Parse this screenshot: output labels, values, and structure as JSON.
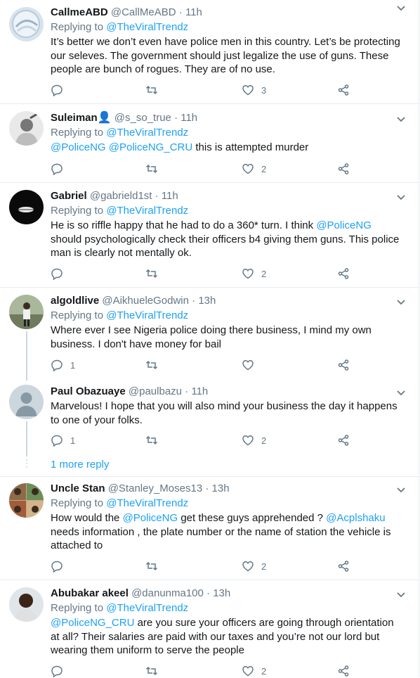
{
  "replying_label": "Replying to",
  "separator": "·",
  "more_replies": "1 more reply",
  "colors": {
    "accent": "#1da1f2",
    "muted": "#657786",
    "border": "#e6ecf0",
    "text": "#14171a"
  },
  "tweets": [
    {
      "name": "CallmeABD",
      "handle": "@CallMeABD",
      "time": "11h",
      "reply_to": "@TheViralTrendz",
      "text": "It’s better we don’t even have police men in this country. Let’s be protecting our seleves.  The government should just legalize the use of guns. These people are bunch of rogues. They are of no use.",
      "replies": "",
      "likes": "3",
      "avatar_icon": "user-avatar"
    },
    {
      "name": "Suleiman",
      "name_emoji": "👤",
      "handle": "@s_so_true",
      "time": "11h",
      "reply_to": "@TheViralTrendz",
      "mention_1": "@PoliceNG",
      "mention_2": "@PoliceNG_CRU",
      "text": "this is attempted murder",
      "replies": "",
      "likes": "2",
      "avatar_icon": "user-avatar"
    },
    {
      "name": "Gabriel",
      "handle": "@gabrield1st",
      "time": "11h",
      "reply_to": "@TheViralTrendz",
      "text_a": "He is so riffle happy that he had to do a 360* turn. I think",
      "mention_1": "@PoliceNG",
      "text_b": "should psychologically check their officers b4 giving them guns. This police man is clearly not mentally ok.",
      "replies": "",
      "likes": "2",
      "avatar_icon": "user-avatar"
    },
    {
      "name": "algoldlive",
      "handle": "@AikhueleGodwin",
      "time": "13h",
      "reply_to": "@TheViralTrendz",
      "text": "Where ever I see Nigeria police doing there business, I mind my own business. I don't have money for bail",
      "replies": "1",
      "likes": "",
      "avatar_icon": "user-avatar"
    },
    {
      "name": "Paul Obazuaye",
      "handle": "@paulbazu",
      "time": "11h",
      "text": "Marvelous! I hope that you will also mind your business the day it happens to one of your folks.",
      "replies": "1",
      "likes": "2",
      "avatar_icon": "default-avatar"
    },
    {
      "name": "Uncle Stan",
      "handle": "@Stanley_Moses13",
      "time": "13h",
      "reply_to": "@TheViralTrendz",
      "text_a": "How would the",
      "mention_1": "@PoliceNG",
      "text_b": "get these guys apprehended ?",
      "mention_2": "@Acplshaku",
      "text_c": "needs information , the plate number or the name of station the vehicle is attached to",
      "replies": "",
      "likes": "2",
      "avatar_icon": "user-avatar"
    },
    {
      "name": "Abubakar akeel",
      "handle": "@danunma100",
      "time": "13h",
      "reply_to": "@TheViralTrendz",
      "mention_1": "@PoliceNG_CRU",
      "text": "are you sure your officers are going through orientation at all? Their salaries are paid with our taxes and you’re not our lord but wearing them uniform to serve the people",
      "replies": "",
      "likes": "2",
      "avatar_icon": "user-avatar"
    }
  ]
}
